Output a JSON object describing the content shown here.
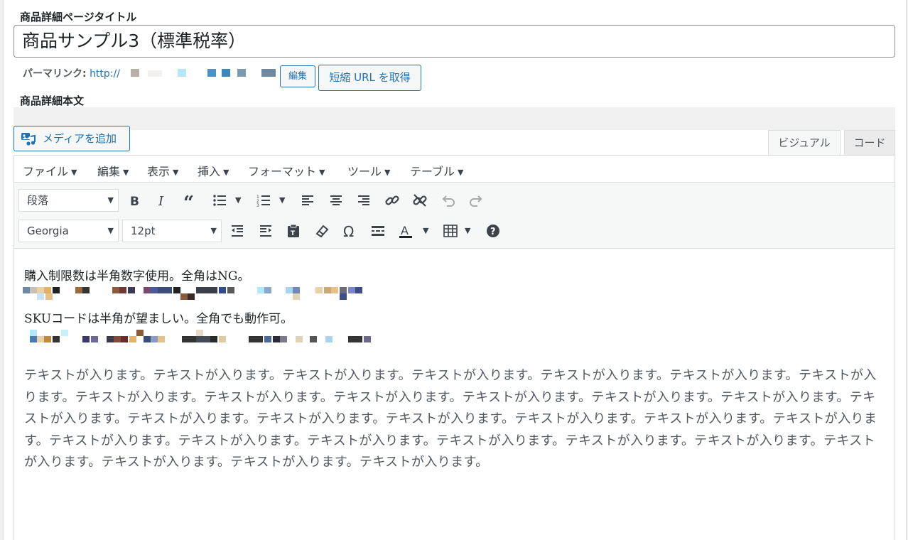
{
  "title_section": {
    "label": "商品詳細ページタイトル",
    "value": "商品サンプル3（標準税率）"
  },
  "permalink": {
    "label": "パーマリンク:",
    "url_prefix": "http://",
    "edit_label": "編集",
    "shortlink_label": "短縮 URL を取得"
  },
  "body_section": {
    "label": "商品詳細本文"
  },
  "editor": {
    "media_button_label": "メディアを追加",
    "tabs": {
      "visual": "ビジュアル",
      "code": "コード"
    },
    "menubar": [
      "ファイル",
      "編集",
      "表示",
      "挿入",
      "フォーマット",
      "ツール",
      "テーブル"
    ],
    "format_select": "段落",
    "font_select": "Georgia",
    "size_select": "12pt",
    "content": {
      "line1": "購入制限数は半角数字使用。全角はNG。",
      "line2": "SKUコードは半角が望ましい。全角でも動作可。",
      "paragraph": "テキストが入ります。テキストが入ります。テキストが入ります。テキストが入ります。テキストが入ります。テキストが入ります。テキストが入ります。テキストが入ります。テキストが入ります。テキストが入ります。テキストが入ります。テキストが入ります。テキストが入ります。テキストが入ります。テキストが入ります。テキストが入ります。テキストが入ります。テキストが入ります。テキストが入ります。テキストが入ります。テキストが入ります。テキストが入ります。テキストが入ります。テキストが入ります。テキストが入ります。テキストが入ります。テキストが入ります。テキストが入ります。テキストが入ります。テキストが入ります。"
    }
  },
  "colors": {
    "accent": "#2271b1",
    "border": "#dcdcde",
    "toolbar_bg": "#f6f7f7"
  },
  "icons": [
    "media-icon",
    "bold-icon",
    "italic-icon",
    "blockquote-icon",
    "bullet-list-icon",
    "numbered-list-icon",
    "align-left-icon",
    "align-center-icon",
    "align-right-icon",
    "link-icon",
    "unlink-icon",
    "undo-icon",
    "redo-icon",
    "outdent-icon",
    "indent-icon",
    "paste-text-icon",
    "clear-formatting-icon",
    "special-character-icon",
    "horizontal-line-icon",
    "text-color-icon",
    "table-icon",
    "help-icon"
  ]
}
